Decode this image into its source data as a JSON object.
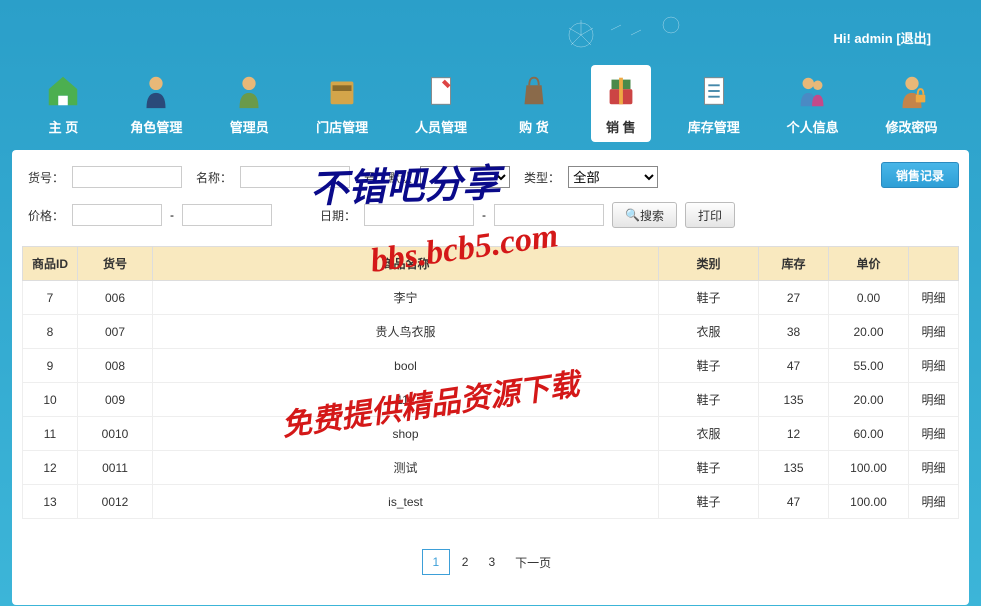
{
  "header": {
    "greeting": "Hi! admin",
    "logout": "[退出]"
  },
  "nav": [
    {
      "label": "主 页",
      "icon": "home"
    },
    {
      "label": "角色管理",
      "icon": "role"
    },
    {
      "label": "管理员",
      "icon": "admin"
    },
    {
      "label": "门店管理",
      "icon": "store"
    },
    {
      "label": "人员管理",
      "icon": "person"
    },
    {
      "label": "购 货",
      "icon": "purchase"
    },
    {
      "label": "销 售",
      "icon": "sale",
      "active": true
    },
    {
      "label": "库存管理",
      "icon": "inventory"
    },
    {
      "label": "个人信息",
      "icon": "profile"
    },
    {
      "label": "修改密码",
      "icon": "password"
    }
  ],
  "filters": {
    "code_label": "货号：",
    "name_label": "名称：",
    "unknown_label": "号：默认",
    "type_label": "类型：",
    "type_value": "全部",
    "price_label": "价格：",
    "date_label": "日期：",
    "dash": "-",
    "search_btn": "搜索",
    "print_btn": "打印",
    "sales_record_btn": "销售记录"
  },
  "table": {
    "headers": [
      "商品ID",
      "货号",
      "商品名称",
      "类别",
      "库存",
      "单价",
      ""
    ],
    "detail_label": "明细",
    "rows": [
      {
        "id": "7",
        "code": "006",
        "name": "李宁",
        "category": "鞋子",
        "stock": "27",
        "price": "0.00"
      },
      {
        "id": "8",
        "code": "007",
        "name": "贵人鸟衣服",
        "category": "衣服",
        "stock": "38",
        "price": "20.00"
      },
      {
        "id": "9",
        "code": "008",
        "name": "bool",
        "category": "鞋子",
        "stock": "47",
        "price": "55.00"
      },
      {
        "id": "10",
        "code": "009",
        "name": "111",
        "category": "鞋子",
        "stock": "135",
        "price": "20.00"
      },
      {
        "id": "11",
        "code": "0010",
        "name": "shop",
        "category": "衣服",
        "stock": "12",
        "price": "60.00"
      },
      {
        "id": "12",
        "code": "0011",
        "name": "测试",
        "category": "鞋子",
        "stock": "135",
        "price": "100.00"
      },
      {
        "id": "13",
        "code": "0012",
        "name": "is_test",
        "category": "鞋子",
        "stock": "47",
        "price": "100.00"
      }
    ]
  },
  "pagination": {
    "pages": [
      "1",
      "2",
      "3"
    ],
    "current": "1",
    "next": "下一页"
  },
  "watermarks": {
    "wm1": "不错吧分享",
    "wm2": "bbs.bcb5.com",
    "wm3": "免费提供精品资源下载"
  }
}
